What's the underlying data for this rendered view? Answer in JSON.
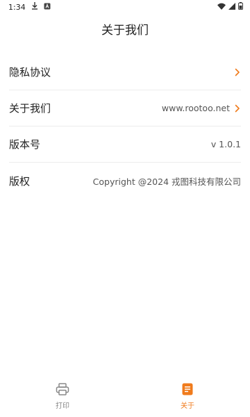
{
  "status_bar": {
    "time": "1:34"
  },
  "header": {
    "title": "关于我们"
  },
  "settings": {
    "items": [
      {
        "label": "隐私协议",
        "value": "",
        "has_chevron": true
      },
      {
        "label": "关于我们",
        "value": "www.rootoo.net",
        "has_chevron": true
      },
      {
        "label": "版本号",
        "value": "v 1.0.1",
        "has_chevron": false
      },
      {
        "label": "版权",
        "value": "Copyright @2024 戎图科技有限公司",
        "has_chevron": false
      }
    ]
  },
  "bottom_nav": {
    "items": [
      {
        "label": "打印",
        "icon": "printer-icon",
        "active": false
      },
      {
        "label": "关于",
        "icon": "document-icon",
        "active": true
      }
    ]
  },
  "colors": {
    "accent": "#f07b1c",
    "inactive": "#888888",
    "divider": "#ececec"
  }
}
